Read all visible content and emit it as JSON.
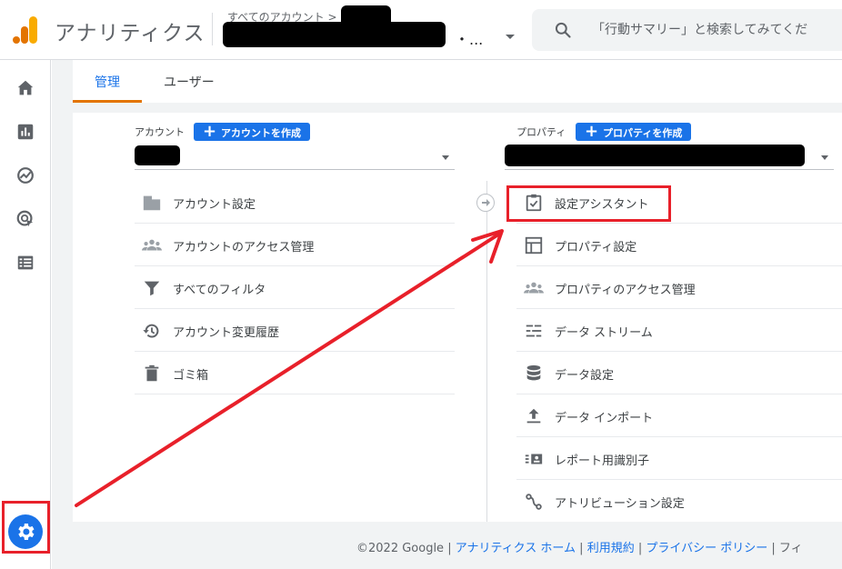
{
  "header": {
    "app_title": "アナリティクス",
    "account_crumb": "すべてのアカウント >",
    "account_name_dots": "・...",
    "search_placeholder": "「行動サマリー」と検索してみてくだ"
  },
  "tabs": [
    {
      "label": "管理",
      "active": true
    },
    {
      "label": "ユーザー",
      "active": false
    }
  ],
  "account_column": {
    "label": "アカウント",
    "create_button": "アカウントを作成",
    "items": [
      {
        "label": "アカウント設定",
        "icon": "building-icon"
      },
      {
        "label": "アカウントのアクセス管理",
        "icon": "people-icon"
      },
      {
        "label": "すべてのフィルタ",
        "icon": "filter-icon"
      },
      {
        "label": "アカウント変更履歴",
        "icon": "history-icon"
      },
      {
        "label": "ゴミ箱",
        "icon": "trash-icon"
      }
    ]
  },
  "property_column": {
    "label": "プロパティ",
    "create_button": "プロパティを作成",
    "items": [
      {
        "label": "設定アシスタント",
        "icon": "checklist-icon"
      },
      {
        "label": "プロパティ設定",
        "icon": "layout-icon"
      },
      {
        "label": "プロパティのアクセス管理",
        "icon": "people-icon"
      },
      {
        "label": "データ ストリーム",
        "icon": "streams-icon"
      },
      {
        "label": "データ設定",
        "icon": "database-icon"
      },
      {
        "label": "データ インポート",
        "icon": "upload-icon"
      },
      {
        "label": "レポート用識別子",
        "icon": "identity-icon"
      },
      {
        "label": "アトリビューション設定",
        "icon": "attribution-icon"
      }
    ]
  },
  "footer": {
    "copyright": "©2022 Google",
    "links": [
      "アナリティクス ホーム",
      "利用規約",
      "プライバシー ポリシー"
    ],
    "separator": " | ",
    "trailing": "フィ"
  },
  "colors": {
    "accent": "#1a73e8",
    "tab_underline": "#e37400",
    "annotation": "#e8202a"
  }
}
